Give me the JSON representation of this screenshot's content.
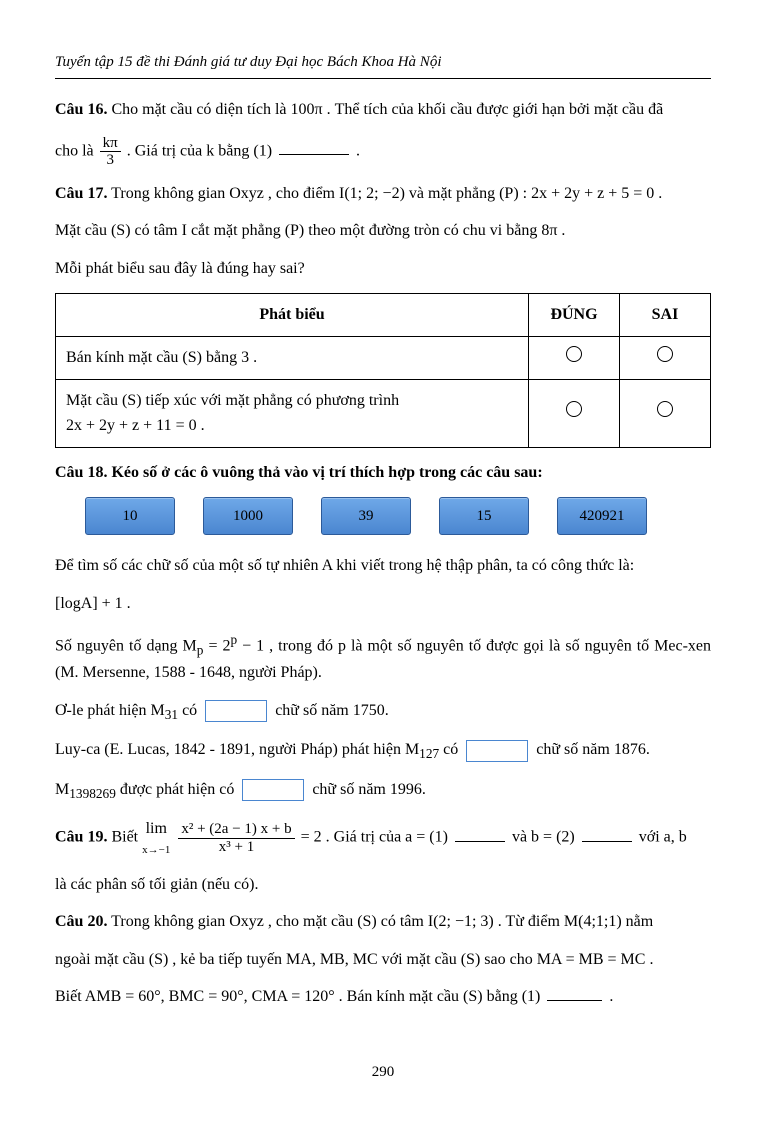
{
  "header": "Tuyển tập 15 đề thi Đánh giá tư duy Đại học Bách Khoa Hà Nội",
  "q16": {
    "label": "Câu 16.",
    "t1": " Cho mặt cầu có diện tích là 100π . Thể tích của khối cầu được giới hạn bởi mặt cầu đã",
    "t2a": "cho là ",
    "frac_num": "kπ",
    "frac_den": "3",
    "t2b": ". Giá trị của  k  bằng (1) ",
    "t2c": "."
  },
  "q17": {
    "label": "Câu 17.",
    "t1": " Trong không gian  Oxyz , cho điểm  I(1; 2; −2)  và mặt phẳng  (P) : 2x + 2y + z + 5 = 0 .",
    "t2": "Mặt cầu  (S)  có tâm I  cắt mặt phẳng  (P)  theo một đường tròn có chu vi bằng 8π .",
    "t3": "Mỗi phát biểu sau đây là đúng hay sai?",
    "th1": "Phát biểu",
    "th2": "ĐÚNG",
    "th3": "SAI",
    "row1": "Bán kính mặt cầu (S) bằng 3 .",
    "row2a": "Mặt  cầu   (S)   tiếp  xúc  với  mặt  phẳng  có  phương  trình",
    "row2b": "2x + 2y + z + 11 = 0 ."
  },
  "q18": {
    "label": "Câu 18.",
    "title": " Kéo số ở các ô vuông thả vào vị trí thích hợp trong các câu sau:",
    "opts": [
      "10",
      "1000",
      "39",
      "15",
      "420921"
    ],
    "p1": "Để tìm số các chữ số của một số tự nhiên  A  khi viết trong hệ thập phân, ta có công thức là:",
    "p1f": "[logA] + 1 .",
    "p2a": "Số nguyên tố dạng  M",
    "p2sub": "p",
    "p2b": " = 2",
    "p2sup": "p",
    "p2c": " − 1 , trong đó  p  là một số nguyên tố được gọi là số nguyên tố Mec-xen (M. Mersenne, 1588 - 1648, người Pháp).",
    "p3a": "Ơ-le phát hiện  M",
    "p3sub": "31",
    "p3b": "  có ",
    "p3c": " chữ số năm 1750.",
    "p4a": "Luy-ca (E. Lucas, 1842 - 1891, người Pháp) phát hiện  M",
    "p4sub": "127",
    "p4b": "  có ",
    "p4c": " chữ số năm 1876.",
    "p5a": "M",
    "p5sub": "1398269",
    "p5b": "  được phát hiện có ",
    "p5c": " chữ số năm 1996."
  },
  "q19": {
    "label": "Câu 19.",
    "t1": " Biết ",
    "lim_top": "lim",
    "lim_bot": "x→−1",
    "frac_num": "x² + (2a − 1) x + b",
    "frac_den": "x³ + 1",
    "t2": " = 2 . Giá trị của a = (1) ",
    "t3": " và b = (2) ",
    "t4": " với  a, b",
    "t5": "là các phân số tối giản (nếu có)."
  },
  "q20": {
    "label": "Câu 20.",
    "t1": " Trong không gian  Oxyz , cho mặt cầu  (S)  có tâm  I(2; −1; 3) . Từ điểm  M(4;1;1)  nằm",
    "t2": "ngoài mặt cầu  (S) , kẻ ba tiếp tuyến  MA, MB, MC  với mặt cầu  (S)  sao cho  MA = MB = MC .",
    "t3a": "Biết  AMB = 60°, BMC = 90°, CMA = 120° . Bán kính mặt cầu  (S)  bằng (1) ",
    "t3b": "."
  },
  "page_num": "290"
}
